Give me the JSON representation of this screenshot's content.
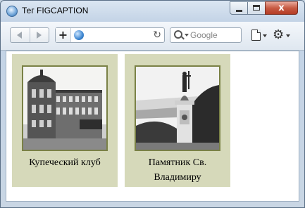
{
  "window": {
    "title": "Тег FIGCAPTION",
    "close_glyph": "x"
  },
  "toolbar": {
    "new_tab_glyph": "+",
    "reload_glyph": "↻",
    "gear_glyph": "⚙",
    "search_placeholder": "Google"
  },
  "content": {
    "figures": [
      {
        "caption": "Купеческий клуб",
        "image": "merchant-club-photo"
      },
      {
        "caption": "Памятник Св. Владимиру",
        "image": "vladimir-monument-photo"
      }
    ]
  }
}
